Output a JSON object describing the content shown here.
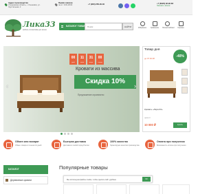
{
  "topbar": {
    "address_title": "Адрес производства",
    "address_text": "Ульяновская область, г. Ульяновск, ул. Хрустальная, 2",
    "sales_title": "Приём заказов",
    "sales_text": "пн-пт: 9:00-18:00",
    "phone_top": "+7 (900) 256-29-30",
    "phone_right": "+7 (8422) 93-92-83",
    "callback_label": "Заказать звонок",
    "social": [
      "vk",
      "viber",
      "whatsapp"
    ]
  },
  "header": {
    "logo_text": "Лика33",
    "logo_sub": "мебель из массива для жизни",
    "catalog_label": "КАТАЛОГ ТОВАРОВ",
    "search_placeholder": "Поиск",
    "search_button": "НАЙТИ",
    "icons": [
      {
        "name": "favorites",
        "label": "Избранное"
      },
      {
        "name": "compare",
        "label": "Сравнение"
      },
      {
        "name": "account",
        "label": "Личный кабинет"
      },
      {
        "name": "cart",
        "label": "Корзина"
      }
    ]
  },
  "hero": {
    "title": "Кровати из массива",
    "discount": "Скидка 10%",
    "subtitle": "Предложение ограничено",
    "timer": [
      {
        "value": "00",
        "unit": "дней"
      },
      {
        "value": "11",
        "unit": "часов"
      },
      {
        "value": "31",
        "unit": "минут"
      },
      {
        "value": "00",
        "unit": "секунд"
      }
    ],
    "dots": 4,
    "active_dot": 0
  },
  "product_of_day": {
    "title": "Товар дня",
    "date": "до 07.02.48",
    "badge": "-40%",
    "name": "Кровать «Лира 03»",
    "price_label": "цена от",
    "price": "10 000 ₽",
    "button": "Купить"
  },
  "advantages": [
    {
      "title": "Обмен или возврат",
      "subtitle": "Обмен товара в течении 14 дней"
    },
    {
      "title": "Быстрая доставка",
      "subtitle": "Доставим в любой город России"
    },
    {
      "title": "100% качество",
      "subtitle": "Гарантируем качество производства"
    },
    {
      "title": "Оплата при получении",
      "subtitle": "Возможность оплаты при получении"
    }
  ],
  "sidebar": {
    "catalog_label": "КАТАЛОГ",
    "items": [
      "Деревянные кровати"
    ]
  },
  "main": {
    "popular_title": "Популярные товары",
    "cookie_text": "Мы используем файлы cookie, чтобы сделать сайт удобнее",
    "cookie_ok": "ОК"
  },
  "colors": {
    "accent_green": "#3e9a55",
    "accent_orange": "#e8643e"
  }
}
